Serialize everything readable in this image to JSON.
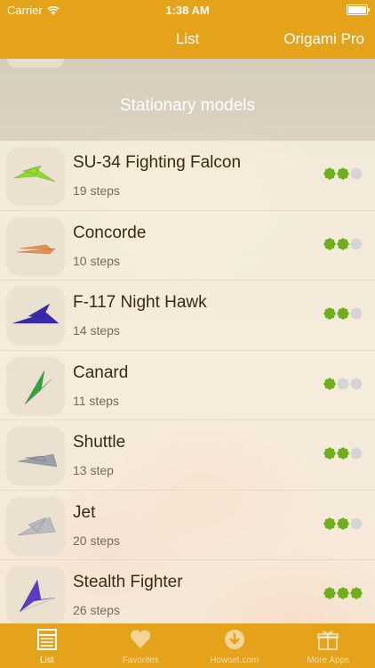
{
  "status": {
    "carrier": "Carrier",
    "time": "1:38 AM",
    "battery_level": 1.0
  },
  "nav": {
    "title": "List",
    "right_button": "Origami Pro"
  },
  "section": {
    "title": "Stationary models"
  },
  "items": [
    {
      "title": "SU-34 Fighting Falcon",
      "steps": "19 steps",
      "difficulty": 2,
      "icon": "plane-icon"
    },
    {
      "title": "Concorde",
      "steps": "10 steps",
      "difficulty": 2,
      "icon": "plane-icon"
    },
    {
      "title": "F-117 Night Hawk",
      "steps": "14 steps",
      "difficulty": 2,
      "icon": "plane-icon"
    },
    {
      "title": "Canard",
      "steps": "11 steps",
      "difficulty": 1,
      "icon": "plane-icon"
    },
    {
      "title": "Shuttle",
      "steps": "13 step",
      "difficulty": 2,
      "icon": "plane-icon"
    },
    {
      "title": "Jet",
      "steps": "20 steps",
      "difficulty": 2,
      "icon": "plane-icon"
    },
    {
      "title": "Stealth Fighter",
      "steps": "26 steps",
      "difficulty": 3,
      "icon": "plane-icon"
    }
  ],
  "tabs": [
    {
      "label": "List",
      "icon": "list-icon",
      "active": true
    },
    {
      "label": "Favorites",
      "icon": "heart-icon",
      "active": false
    },
    {
      "label": "Howset.com",
      "icon": "download-icon",
      "active": false
    },
    {
      "label": "More Apps",
      "icon": "gift-icon",
      "active": false
    }
  ],
  "colors": {
    "accent": "#e5a31c",
    "dot_on": "#6fae1c",
    "dot_off": "#d5d5d5",
    "model_colors": [
      "#8fdc2c",
      "#e8904a",
      "#3a2ab0",
      "#2aa83c",
      "#9aa0a8",
      "#b8bcc2",
      "#5a3cc8"
    ]
  }
}
